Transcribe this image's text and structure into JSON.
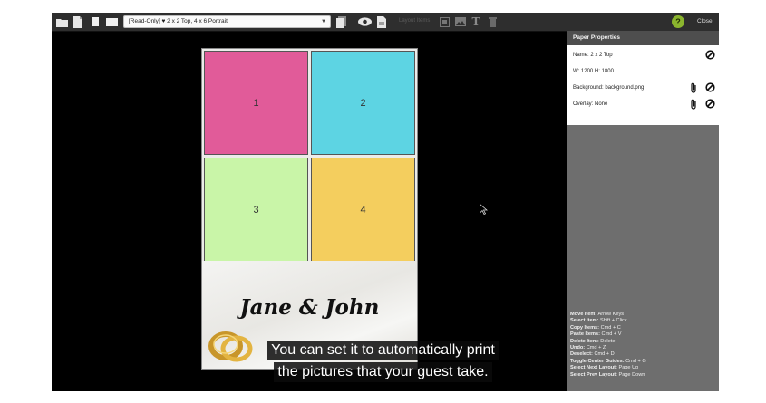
{
  "toolbar": {
    "layout_select_value": "[Read-Only] ♥ 2 x 2 Top, 4 x 6 Portrait",
    "layout_items_label": "Layout Items",
    "help_label": "?",
    "close_label": "Close"
  },
  "paper": {
    "slots": [
      {
        "label": "1",
        "color": "#E15B99"
      },
      {
        "label": "2",
        "color": "#5DD4E3"
      },
      {
        "label": "3",
        "color": "#C9F5A8"
      },
      {
        "label": "4",
        "color": "#F4CE5E"
      }
    ],
    "names": "Jane & John"
  },
  "panel": {
    "title": "Paper Properties",
    "name": "Name: 2 x 2 Top",
    "size": "W: 1200 H: 1800",
    "background": "Background: background.png",
    "overlay": "Overlay: None"
  },
  "shortcuts": [
    {
      "key": "Move Item:",
      "value": "Arrow Keys"
    },
    {
      "key": "Select Item:",
      "value": "Shift + Click"
    },
    {
      "key": "Copy Items:",
      "value": "Cmd + C"
    },
    {
      "key": "Paste Items:",
      "value": "Cmd + V"
    },
    {
      "key": "Delete Item:",
      "value": "Delete"
    },
    {
      "key": "Undo:",
      "value": "Cmd + Z"
    },
    {
      "key": "Deselect:",
      "value": "Cmd + D"
    },
    {
      "key": "Toggle Center Guides:",
      "value": "Cmd + G"
    },
    {
      "key": "Select Next Layout:",
      "value": "Page Up"
    },
    {
      "key": "Select Prev Layout:",
      "value": "Page Down"
    }
  ],
  "captions": {
    "line1": "You can set it to automatically print",
    "line2": "the pictures that your guest take."
  }
}
